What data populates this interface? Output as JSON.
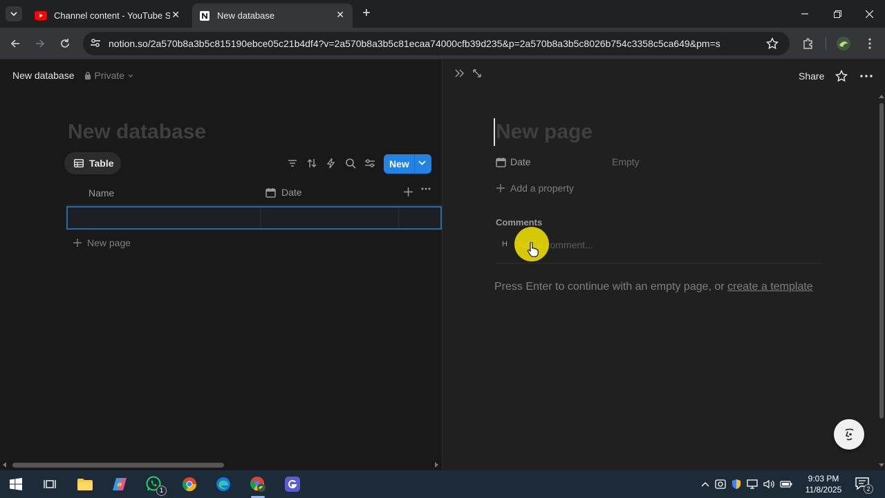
{
  "browser": {
    "tabs": [
      {
        "title": "Channel content - YouTube Studio",
        "active": false,
        "icon": "youtube-icon"
      },
      {
        "title": "New database",
        "active": true,
        "icon": "notion-icon"
      }
    ],
    "url": "notion.so/2a570b8a3b5c815190ebce05c21b4df4?v=2a570b8a3b5c81ecaa74000cfb39d235&p=2a570b8a3b5c8026b754c3358c5ca649&pm=s"
  },
  "notion": {
    "breadcrumb": "New database",
    "privacy": "Private",
    "database": {
      "title": "New database",
      "view_tab": "Table",
      "new_button": "New",
      "columns": [
        "Name",
        "Date"
      ],
      "new_row": "New page"
    },
    "peek": {
      "share": "Share",
      "page_title_placeholder": "New page",
      "property_name": "Date",
      "property_value": "Empty",
      "add_property": "Add a property",
      "comments_label": "Comments",
      "avatar_initial": "H",
      "comment_placeholder": "Add a comment...",
      "hint_text": "Press Enter to continue with an empty page, or",
      "hint_link": "create a template"
    }
  },
  "taskbar": {
    "whatsapp_badge": "1",
    "time": "9:03 PM",
    "date": "11/8/2025",
    "notification_count": "2"
  },
  "colors": {
    "accent": "#2383e2",
    "background": "#191919",
    "peek_background": "#202020",
    "cursor_highlight": "#f7e600"
  }
}
